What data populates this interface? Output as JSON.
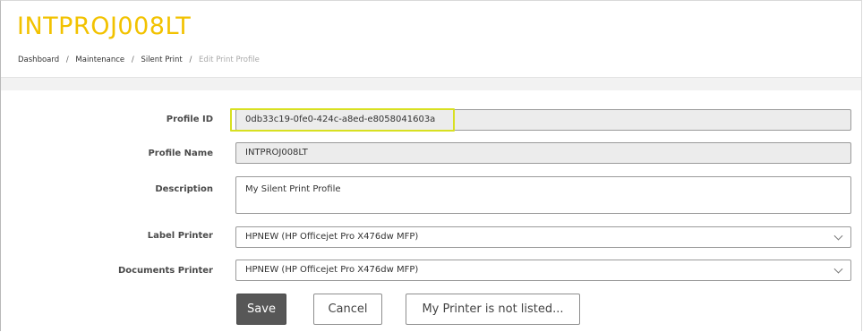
{
  "header": {
    "title": "INTPROJ008LT",
    "breadcrumb": [
      "Dashboard",
      "Maintenance",
      "Silent Print",
      "Edit Print Profile"
    ],
    "breadcrumb_separator": "/"
  },
  "form": {
    "profile_id": {
      "label": "Profile ID",
      "value": "0db33c19-0fe0-424c-a8ed-e8058041603a"
    },
    "profile_name": {
      "label": "Profile Name",
      "value": "INTPROJ008LT"
    },
    "description": {
      "label": "Description",
      "value": "My Silent Print Profile"
    },
    "label_printer": {
      "label": "Label Printer",
      "value": "HPNEW (HP Officejet Pro X476dw MFP)"
    },
    "documents_printer": {
      "label": "Documents Printer",
      "value": "HPNEW (HP Officejet Pro X476dw MFP)"
    }
  },
  "buttons": {
    "save": "Save",
    "cancel": "Cancel",
    "not_listed": "My Printer is not listed..."
  },
  "colors": {
    "title": "#f2c200",
    "highlight": "#d8e021",
    "save_button": "#575757"
  }
}
